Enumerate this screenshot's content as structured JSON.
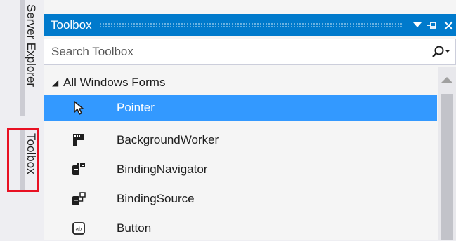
{
  "side_tabs": [
    {
      "label": "Server Explorer"
    },
    {
      "label": "Toolbox"
    }
  ],
  "toolbox": {
    "title": "Toolbox",
    "search_placeholder": "Search Toolbox",
    "group": {
      "label": "All Windows Forms"
    },
    "items": [
      {
        "label": "Pointer",
        "icon": "pointer-icon",
        "selected": true
      },
      {
        "label": "BackgroundWorker",
        "icon": "background-worker-icon"
      },
      {
        "label": "BindingNavigator",
        "icon": "binding-navigator-icon"
      },
      {
        "label": "BindingSource",
        "icon": "binding-source-icon"
      },
      {
        "label": "Button",
        "icon": "button-icon"
      }
    ]
  },
  "colors": {
    "accent": "#007acc",
    "selection": "#3399ff",
    "highlight_box": "#e81123"
  }
}
